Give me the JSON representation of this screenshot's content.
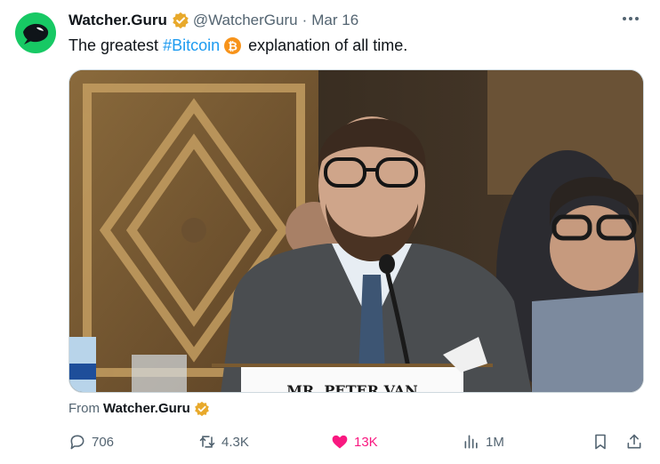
{
  "tweet": {
    "author_name": "Watcher.Guru",
    "handle": "@WatcherGuru",
    "separator": "·",
    "date": "Mar 16",
    "text_before": "The greatest",
    "hashtag": "#Bitcoin",
    "text_after": "explanation of all time.",
    "media_caption_visible": "MR. PETER VAN",
    "from_label": "From",
    "from_source": "Watcher.Guru"
  },
  "actions": {
    "replies": "706",
    "reposts": "4.3K",
    "likes": "13K",
    "views": "1M"
  },
  "colors": {
    "accent": "#1d9bf0",
    "verified": "#e8a92b",
    "like": "#f91880",
    "avatar_bg": "#17c964",
    "muted": "#536471"
  },
  "icons": [
    "verified-badge-icon",
    "bitcoin-icon",
    "more-icon",
    "reply-icon",
    "repost-icon",
    "like-icon",
    "views-icon",
    "bookmark-icon",
    "share-icon"
  ]
}
